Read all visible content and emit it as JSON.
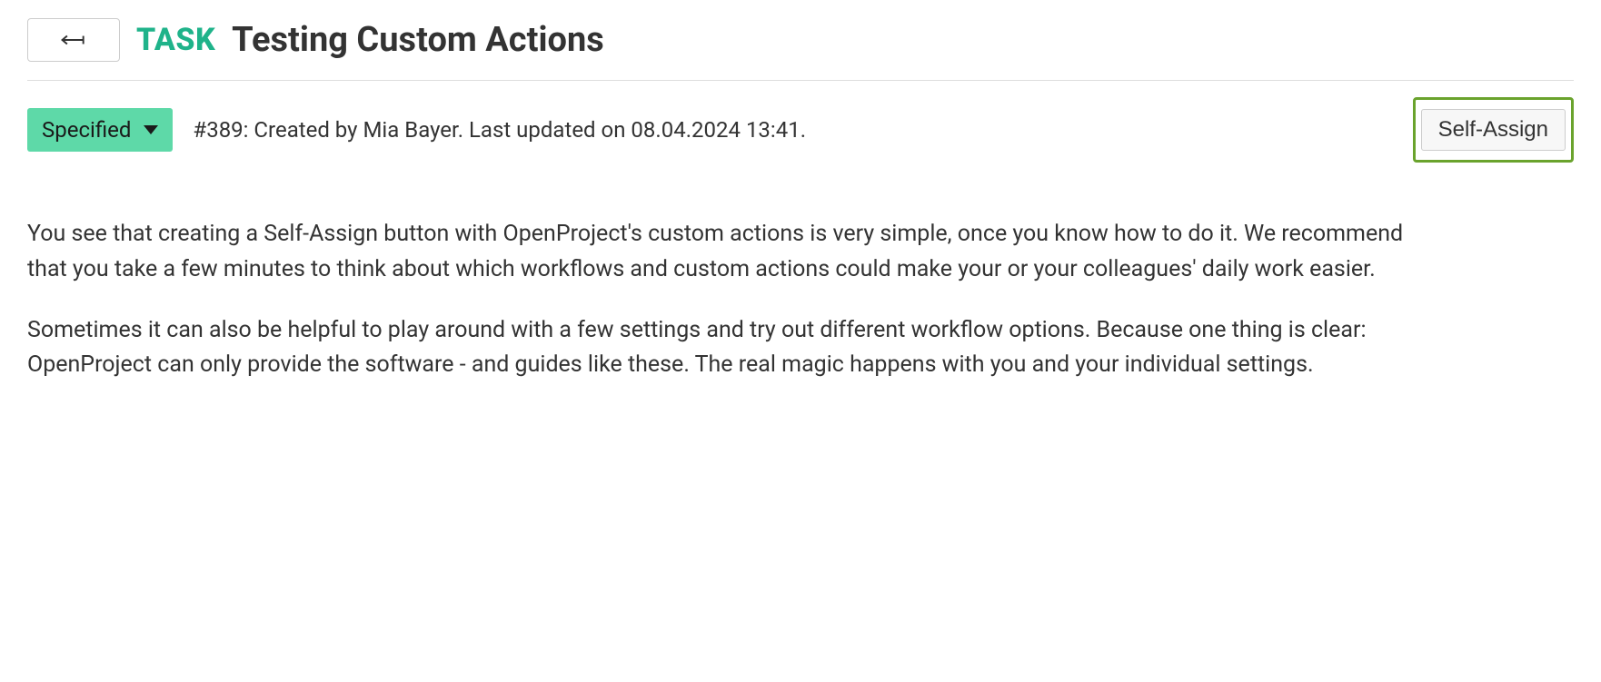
{
  "header": {
    "type_label": "TASK",
    "title": "Testing Custom Actions"
  },
  "status": {
    "label": "Specified"
  },
  "meta": {
    "info": "#389: Created by Mia Bayer. Last updated on 08.04.2024 13:41."
  },
  "actions": {
    "self_assign_label": "Self-Assign"
  },
  "description": {
    "paragraph1": "You see that creating a Self-Assign button with OpenProject's custom actions is very simple, once you know how to do it. We recommend that you take a few minutes to think about which workflows and custom actions could make your or your colleagues' daily work easier.",
    "paragraph2": "Sometimes it can also be helpful to play around with a few settings and try out different workflow options. Because one thing is clear: OpenProject can only provide the software - and guides like these. The real magic happens with you and your individual settings."
  }
}
